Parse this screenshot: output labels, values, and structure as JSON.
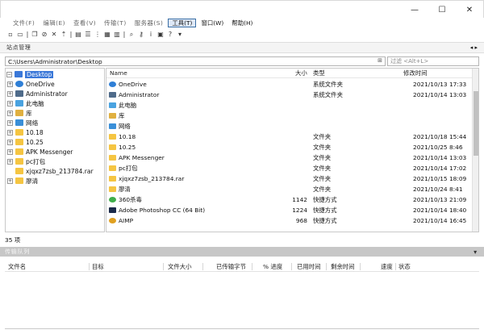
{
  "window": {
    "minimize": "—",
    "maximize": "☐",
    "close": "✕"
  },
  "menubar": {
    "items": [
      {
        "label": "文件(F)",
        "faded": true
      },
      {
        "label": "编辑(E)",
        "faded": true
      },
      {
        "label": "查看(V)",
        "faded": true
      },
      {
        "label": "传输(T)",
        "faded": true
      },
      {
        "label": "服务器(S)",
        "faded": true
      },
      {
        "label": "工具(T)",
        "active": true
      },
      {
        "label": "窗口(W)"
      },
      {
        "label": "帮助(H)"
      }
    ]
  },
  "connbar": {
    "label": "站点管理"
  },
  "address": {
    "path": "C:\\Users\\Administrator\\Desktop",
    "filter_placeholder": "过滤 <Alt+L>"
  },
  "tree": {
    "items": [
      {
        "label": "Desktop",
        "expander": "−",
        "icon": "desktop-icon",
        "selected": true,
        "indent": 0
      },
      {
        "label": "OneDrive",
        "expander": "+",
        "icon": "cloud-icon",
        "indent": 1
      },
      {
        "label": "Administrator",
        "expander": "+",
        "icon": "user-icon",
        "indent": 1
      },
      {
        "label": "此电脑",
        "expander": "+",
        "icon": "computer-icon",
        "indent": 1
      },
      {
        "label": "库",
        "expander": "+",
        "icon": "library-icon",
        "indent": 1
      },
      {
        "label": "网络",
        "expander": "+",
        "icon": "network-icon",
        "indent": 1
      },
      {
        "label": "10.18",
        "expander": "+",
        "icon": "folder-icon",
        "indent": 1
      },
      {
        "label": "10.25",
        "expander": "+",
        "icon": "folder-icon",
        "indent": 1
      },
      {
        "label": "APK Messenger",
        "expander": "+",
        "icon": "folder-icon",
        "indent": 1
      },
      {
        "label": "pc打包",
        "expander": "+",
        "icon": "folder-icon",
        "indent": 1
      },
      {
        "label": "xjqxz7zsb_213784.rar",
        "expander": "",
        "icon": "folder-icon",
        "indent": 1
      },
      {
        "label": "廖清",
        "expander": "+",
        "icon": "folder-icon",
        "indent": 1
      }
    ]
  },
  "list": {
    "columns": {
      "name": "Name",
      "size": "大小",
      "type": "类型",
      "modified": "修改时间"
    },
    "rows": [
      {
        "name": "OneDrive",
        "size": "",
        "type": "系统文件夹",
        "modified": "2021/10/13 17:33",
        "icon": "cloud"
      },
      {
        "name": "Administrator",
        "size": "",
        "type": "系统文件夹",
        "modified": "2021/10/14 13:03",
        "icon": "user"
      },
      {
        "name": "此电脑",
        "size": "",
        "type": "",
        "modified": "",
        "icon": "computer"
      },
      {
        "name": "库",
        "size": "",
        "type": "",
        "modified": "",
        "icon": "library"
      },
      {
        "name": "网络",
        "size": "",
        "type": "",
        "modified": "",
        "icon": "network"
      },
      {
        "name": "10.18",
        "size": "",
        "type": "文件夹",
        "modified": "2021/10/18 15:44",
        "icon": "folder"
      },
      {
        "name": "10.25",
        "size": "",
        "type": "文件夹",
        "modified": "2021/10/25 8:46",
        "icon": "folder"
      },
      {
        "name": "APK Messenger",
        "size": "",
        "type": "文件夹",
        "modified": "2021/10/14 13:03",
        "icon": "folder"
      },
      {
        "name": "pc打包",
        "size": "",
        "type": "文件夹",
        "modified": "2021/10/14 17:02",
        "icon": "folder"
      },
      {
        "name": "xjqxz7zsb_213784.rar",
        "size": "",
        "type": "文件夹",
        "modified": "2021/10/15 18:09",
        "icon": "folder"
      },
      {
        "name": "廖清",
        "size": "",
        "type": "文件夹",
        "modified": "2021/10/24 8:41",
        "icon": "folder"
      },
      {
        "name": "360杀毒",
        "size": "1142",
        "type": "快捷方式",
        "modified": "2021/10/13 21:09",
        "icon": "shortcut-green"
      },
      {
        "name": "Adobe Photoshop CC (64 Bit)",
        "size": "1224",
        "type": "快捷方式",
        "modified": "2021/10/14 18:40",
        "icon": "shortcut-ps"
      },
      {
        "name": "AIMP",
        "size": "968",
        "type": "快捷方式",
        "modified": "2021/10/14 16:45",
        "icon": "shortcut-aimp"
      }
    ]
  },
  "status": {
    "count": "35 项"
  },
  "queue": {
    "title": "传输队列",
    "columns": {
      "file": "文件名",
      "target": "目标",
      "size": "文件大小",
      "transferred": "已传输字节",
      "progress": "% 进度",
      "elapsed": "已用时间",
      "remaining": "剩余时间",
      "speed": "速度",
      "state": "状态"
    }
  },
  "colors": {
    "selection": "#3b78d8",
    "folder": "#f5c542",
    "queue_header": "#c7c7c7"
  }
}
